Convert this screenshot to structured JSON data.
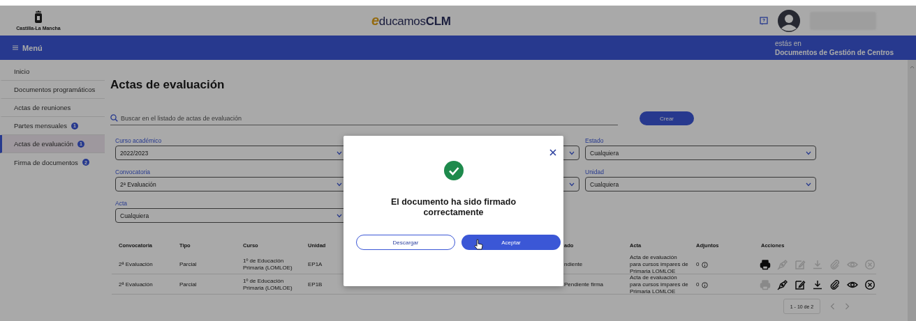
{
  "header": {
    "region_name": "Castilla-La Mancha",
    "brand": {
      "initial": "e",
      "name": "ducamos",
      "suffix": "CLM"
    }
  },
  "menu_bar": {
    "menu_label": "Menú",
    "location_caption": "estás en",
    "location": "Documentos de Gestión de Centros"
  },
  "sidebar": {
    "items": [
      {
        "label": "Inicio",
        "selected": false
      },
      {
        "label": "Documentos programáticos",
        "selected": false
      },
      {
        "label": "Actas de reuniones",
        "selected": false
      },
      {
        "label": "Partes mensuales",
        "badge": "1",
        "selected": false
      },
      {
        "label": "Actas de evaluación",
        "badge": "1",
        "selected": true
      },
      {
        "label": "Firma de documentos",
        "badge": "2",
        "selected": false
      }
    ]
  },
  "page": {
    "title": "Actas de evaluación",
    "search": {
      "placeholder": "Buscar en el listado de actas de evaluación"
    },
    "create_button": "Crear"
  },
  "filters": {
    "column_1": [
      {
        "label": "Curso académico",
        "value": "2022/2023"
      },
      {
        "label": "Convocatoria",
        "value": "2ª Evaluación"
      },
      {
        "label": "Acta",
        "value": "Cualquiera"
      }
    ],
    "column_3": [
      {
        "label": "Estado",
        "value": "Cualquiera"
      },
      {
        "label": "Unidad",
        "value": "Cualquiera"
      }
    ]
  },
  "table": {
    "columns": [
      "Convocatoria",
      "Tipo",
      "Curso",
      "Unidad",
      "ado",
      "Acta",
      "Adjuntos",
      "Acciones"
    ],
    "rows": [
      {
        "cells": [
          "2ª Evaluación",
          "Parcial",
          "1º de Educación Primaria (LOMLOE)",
          "EP1A",
          "ndiente",
          "Acta de evaluación para cursos impares de Primaria LOMLOE"
        ],
        "attachments": "0",
        "actions": [
          {
            "kind": "print",
            "disabled": false
          },
          {
            "kind": "sign",
            "disabled": true
          },
          {
            "kind": "edit",
            "disabled": true
          },
          {
            "kind": "download",
            "disabled": true
          },
          {
            "kind": "attach",
            "disabled": true
          },
          {
            "kind": "view",
            "disabled": true
          },
          {
            "kind": "cancel",
            "disabled": true
          }
        ]
      },
      {
        "cells": [
          "2ª Evaluación",
          "Parcial",
          "1º de Educación Primaria (LOMLOE)",
          "EP1B",
          "Pendiente firma",
          "Acta de evaluación para cursos impares de Primaria LOMLOE"
        ],
        "attachments": "0",
        "actions": [
          {
            "kind": "print",
            "disabled": true
          },
          {
            "kind": "sign",
            "disabled": false
          },
          {
            "kind": "edit",
            "disabled": false
          },
          {
            "kind": "download",
            "disabled": false
          },
          {
            "kind": "attach",
            "disabled": false
          },
          {
            "kind": "view",
            "disabled": false
          },
          {
            "kind": "cancel",
            "disabled": false
          }
        ]
      }
    ]
  },
  "pagination": {
    "range": "1 - 10 de 2"
  },
  "dialog": {
    "message": "El documento ha sido firmado correctamente",
    "buttons": [
      {
        "label": "Descargar",
        "kind": "secondary"
      },
      {
        "label": "Aceptar",
        "kind": "primary"
      }
    ]
  }
}
